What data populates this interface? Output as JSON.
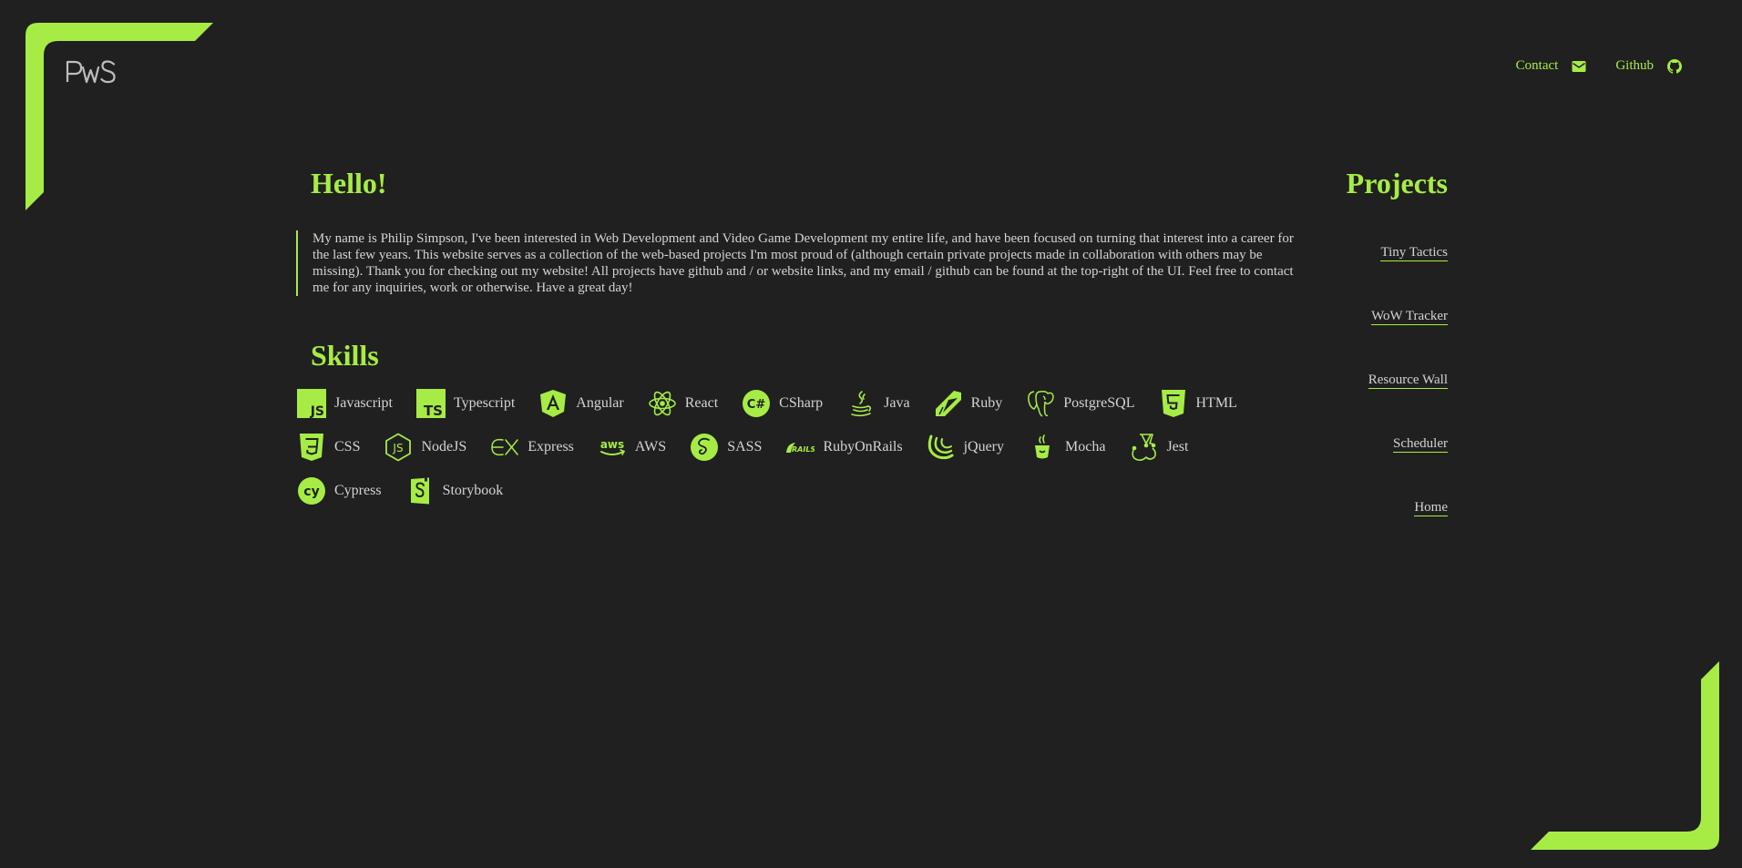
{
  "brand": {
    "logo_text": "PWS",
    "accent": "#a6ec45",
    "background": "#202020",
    "text": "#d4d4d4"
  },
  "nav": {
    "contact": {
      "label": "Contact",
      "icon": "envelope-icon"
    },
    "github": {
      "label": "Github",
      "icon": "github-icon"
    }
  },
  "hello": {
    "heading": "Hello!",
    "text": "My name is Philip Simpson, I've been interested in Web Development and Video Game Development my entire life, and have been focused on turning that interest into a career for the last few years. This website serves as a collection of the web-based projects I'm most proud of (although certain private projects made in collaboration with others may be missing). Thank you for checking out my website! All projects have github and / or website links, and my email / github can be found at the top-right of the UI. Feel free to contact me for any inquiries, work or otherwise. Have a great day!"
  },
  "skills": {
    "heading": "Skills",
    "items": [
      {
        "label": "Javascript",
        "icon": "javascript-icon"
      },
      {
        "label": "Typescript",
        "icon": "typescript-icon"
      },
      {
        "label": "Angular",
        "icon": "angular-icon"
      },
      {
        "label": "React",
        "icon": "react-icon"
      },
      {
        "label": "CSharp",
        "icon": "csharp-icon"
      },
      {
        "label": "Java",
        "icon": "java-icon"
      },
      {
        "label": "Ruby",
        "icon": "ruby-icon"
      },
      {
        "label": "PostgreSQL",
        "icon": "postgresql-icon"
      },
      {
        "label": "HTML",
        "icon": "html5-icon"
      },
      {
        "label": "CSS",
        "icon": "css3-icon"
      },
      {
        "label": "NodeJS",
        "icon": "nodejs-icon"
      },
      {
        "label": "Express",
        "icon": "express-icon"
      },
      {
        "label": "AWS",
        "icon": "aws-icon"
      },
      {
        "label": "SASS",
        "icon": "sass-icon"
      },
      {
        "label": "RubyOnRails",
        "icon": "rails-icon"
      },
      {
        "label": "jQuery",
        "icon": "jquery-icon"
      },
      {
        "label": "Mocha",
        "icon": "mocha-icon"
      },
      {
        "label": "Jest",
        "icon": "jest-icon"
      },
      {
        "label": "Cypress",
        "icon": "cypress-icon"
      },
      {
        "label": "Storybook",
        "icon": "storybook-icon"
      }
    ]
  },
  "projects": {
    "heading": "Projects",
    "items": [
      "Tiny Tactics",
      "WoW Tracker",
      "Resource Wall",
      "Scheduler",
      "Home"
    ]
  }
}
